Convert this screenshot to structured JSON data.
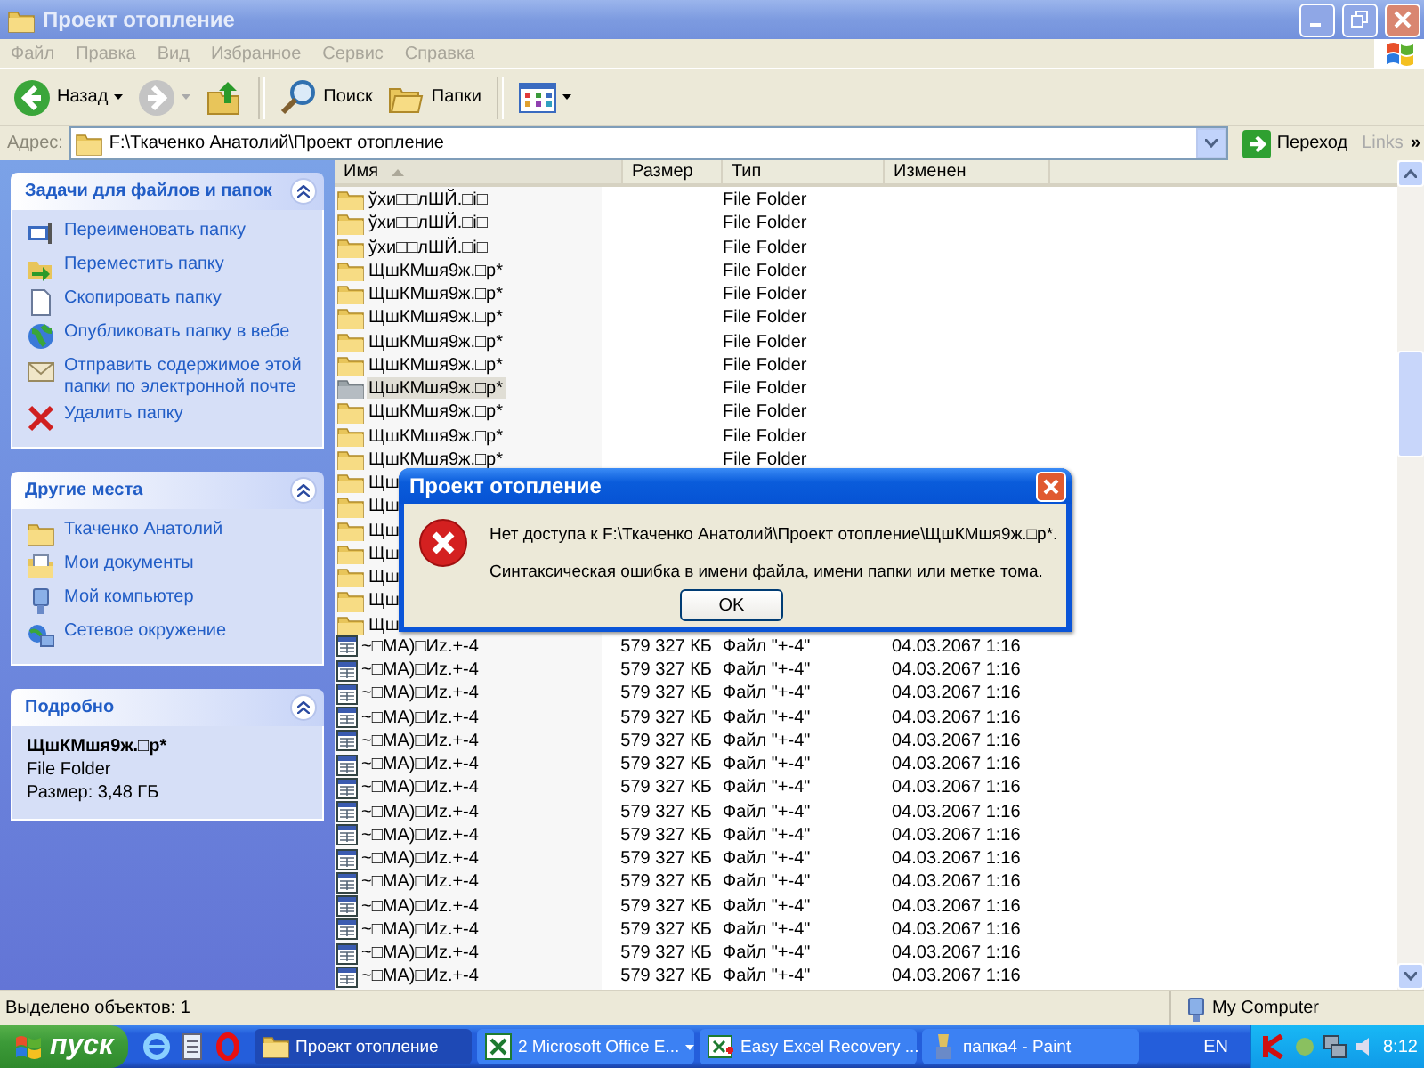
{
  "window": {
    "title": "Проект отопление"
  },
  "menu": [
    "Файл",
    "Правка",
    "Вид",
    "Избранное",
    "Сервис",
    "Справка"
  ],
  "toolbar": [
    {
      "kind": "back",
      "label": "Назад",
      "disabled": false
    },
    {
      "kind": "forward",
      "disabled": true
    },
    {
      "kind": "up",
      "disabled": false
    },
    {
      "kind": "search",
      "label": "Поиск",
      "disabled": false
    },
    {
      "kind": "folders",
      "label": "Папки",
      "disabled": false
    },
    {
      "kind": "views",
      "disabled": false
    }
  ],
  "address": {
    "label": "Адрес:",
    "value": "F:\\Ткаченко Анатолий\\Проект отопление",
    "go": "Переход",
    "links": "Links",
    "more": "»"
  },
  "sidebar": [
    {
      "kind": "links",
      "title": "Задачи для файлов и папок",
      "items": [
        {
          "kind": "rename",
          "label": "Переименовать папку"
        },
        {
          "kind": "move",
          "label": "Переместить папку"
        },
        {
          "kind": "copy",
          "label": "Скопировать папку"
        },
        {
          "kind": "publish",
          "label": "Опубликовать папку в вебе"
        },
        {
          "kind": "email",
          "label": "Отправить содержимое этой папки по электронной почте"
        },
        {
          "kind": "delete",
          "label": "Удалить папку"
        }
      ]
    },
    {
      "kind": "links",
      "title": "Другие места",
      "items": [
        {
          "kind": "folder",
          "label": "Ткаченко Анатолий"
        },
        {
          "kind": "documents",
          "label": "Мои документы"
        },
        {
          "kind": "computer",
          "label": "Мой компьютер"
        },
        {
          "kind": "network",
          "label": "Сетевое окружение"
        }
      ]
    },
    {
      "kind": "details",
      "title": "Подробно",
      "name": "ЩшКМшя9ж.□р*",
      "type": "File Folder",
      "size": "Размер: 3,48 ГБ"
    }
  ],
  "file_list": {
    "columns": [
      {
        "label": "Имя",
        "sorted": true
      },
      {
        "label": "Размер",
        "sorted": false
      },
      {
        "label": "Тип",
        "sorted": false
      },
      {
        "label": "Изменен",
        "sorted": false
      }
    ],
    "rows": [
      {
        "kind": "folder",
        "name": "ўхи□□лШЙ.□і□",
        "type": "File Folder",
        "selected": false
      },
      {
        "kind": "folder",
        "name": "ўхи□□лШЙ.□і□",
        "type": "File Folder",
        "selected": false
      },
      {
        "kind": "folder",
        "name": "ўхи□□лШЙ.□і□",
        "type": "File Folder",
        "selected": false
      },
      {
        "kind": "folder",
        "name": "ЩшКМшя9ж.□р*",
        "type": "File Folder",
        "selected": false
      },
      {
        "kind": "folder",
        "name": "ЩшКМшя9ж.□р*",
        "type": "File Folder",
        "selected": false
      },
      {
        "kind": "folder",
        "name": "ЩшКМшя9ж.□р*",
        "type": "File Folder",
        "selected": false
      },
      {
        "kind": "folder",
        "name": "ЩшКМшя9ж.□р*",
        "type": "File Folder",
        "selected": false
      },
      {
        "kind": "folder",
        "name": "ЩшКМшя9ж.□р*",
        "type": "File Folder",
        "selected": false
      },
      {
        "kind": "folder",
        "name": "ЩшКМшя9ж.□р*",
        "type": "File Folder",
        "selected": true
      },
      {
        "kind": "folder",
        "name": "ЩшКМшя9ж.□р*",
        "type": "File Folder",
        "selected": false
      },
      {
        "kind": "folder",
        "name": "ЩшКМшя9ж.□р*",
        "type": "File Folder",
        "selected": false
      },
      {
        "kind": "folder",
        "name": "ЩшКМшя9ж.□р*",
        "type": "File Folder",
        "selected": false
      },
      {
        "kind": "folder",
        "name": "Щш",
        "selected": false
      },
      {
        "kind": "folder",
        "name": "Щш",
        "selected": false
      },
      {
        "kind": "folder",
        "name": "Щш",
        "selected": false
      },
      {
        "kind": "folder",
        "name": "Щш",
        "selected": false
      },
      {
        "kind": "folder",
        "name": "Щш",
        "selected": false
      },
      {
        "kind": "folder",
        "name": "Щш",
        "selected": false
      },
      {
        "kind": "folder",
        "name": "Щш",
        "selected": false
      },
      {
        "kind": "file",
        "name": "~□МА)□Иz.+-4",
        "size": "579 327 КБ",
        "type": "Файл \"+-4\"",
        "modified": "04.03.2067 1:16",
        "selected": false
      },
      {
        "kind": "file",
        "name": "~□МА)□Иz.+-4",
        "size": "579 327 КБ",
        "type": "Файл \"+-4\"",
        "modified": "04.03.2067 1:16",
        "selected": false
      },
      {
        "kind": "file",
        "name": "~□МА)□Иz.+-4",
        "size": "579 327 КБ",
        "type": "Файл \"+-4\"",
        "modified": "04.03.2067 1:16",
        "selected": false
      },
      {
        "kind": "file",
        "name": "~□МА)□Иz.+-4",
        "size": "579 327 КБ",
        "type": "Файл \"+-4\"",
        "modified": "04.03.2067 1:16",
        "selected": false
      },
      {
        "kind": "file",
        "name": "~□МА)□Иz.+-4",
        "size": "579 327 КБ",
        "type": "Файл \"+-4\"",
        "modified": "04.03.2067 1:16",
        "selected": false
      },
      {
        "kind": "file",
        "name": "~□МА)□Иz.+-4",
        "size": "579 327 КБ",
        "type": "Файл \"+-4\"",
        "modified": "04.03.2067 1:16",
        "selected": false
      },
      {
        "kind": "file",
        "name": "~□МА)□Иz.+-4",
        "size": "579 327 КБ",
        "type": "Файл \"+-4\"",
        "modified": "04.03.2067 1:16",
        "selected": false
      },
      {
        "kind": "file",
        "name": "~□МА)□Иz.+-4",
        "size": "579 327 КБ",
        "type": "Файл \"+-4\"",
        "modified": "04.03.2067 1:16",
        "selected": false
      },
      {
        "kind": "file",
        "name": "~□МА)□Иz.+-4",
        "size": "579 327 КБ",
        "type": "Файл \"+-4\"",
        "modified": "04.03.2067 1:16",
        "selected": false
      },
      {
        "kind": "file",
        "name": "~□МА)□Иz.+-4",
        "size": "579 327 КБ",
        "type": "Файл \"+-4\"",
        "modified": "04.03.2067 1:16",
        "selected": false
      },
      {
        "kind": "file",
        "name": "~□МА)□Иz.+-4",
        "size": "579 327 КБ",
        "type": "Файл \"+-4\"",
        "modified": "04.03.2067 1:16",
        "selected": false
      },
      {
        "kind": "file",
        "name": "~□МА)□Иz.+-4",
        "size": "579 327 КБ",
        "type": "Файл \"+-4\"",
        "modified": "04.03.2067 1:16",
        "selected": false
      },
      {
        "kind": "file",
        "name": "~□МА)□Иz.+-4",
        "size": "579 327 КБ",
        "type": "Файл \"+-4\"",
        "modified": "04.03.2067 1:16",
        "selected": false
      },
      {
        "kind": "file",
        "name": "~□МА)□Иz.+-4",
        "size": "579 327 КБ",
        "type": "Файл \"+-4\"",
        "modified": "04.03.2067 1:16",
        "selected": false
      },
      {
        "kind": "file",
        "name": "~□МА)□Иz.+-4",
        "size": "579 327 КБ",
        "type": "Файл \"+-4\"",
        "modified": "04.03.2067 1:16",
        "selected": false
      }
    ]
  },
  "dialog": {
    "title": "Проект отопление",
    "message": "Нет доступа к F:\\Ткаченко Анатолий\\Проект отопление\\ЩшКМшя9ж.□р*.",
    "detail": "Синтаксическая ошибка в имени файла, имени папки или метке тома.",
    "button": "OK"
  },
  "status_bar": {
    "text": "Выделено объектов: 1",
    "zone": "My Computer"
  },
  "taskbar": {
    "start": "пуск",
    "quick_launch": [
      {
        "kind": "browser"
      },
      {
        "kind": "notepad"
      },
      {
        "kind": "opera"
      }
    ],
    "tasks": [
      {
        "kind": "folder",
        "label": "Проект отопление",
        "selected": true
      },
      {
        "kind": "excel",
        "label": "2 Microsoft Office E...",
        "selected": false
      },
      {
        "kind": "recovery",
        "label": "Easy Excel Recovery ...",
        "selected": false
      },
      {
        "kind": "paint",
        "label": "папка4 - Paint",
        "selected": false
      }
    ],
    "language": "EN",
    "clock": "8:12"
  }
}
